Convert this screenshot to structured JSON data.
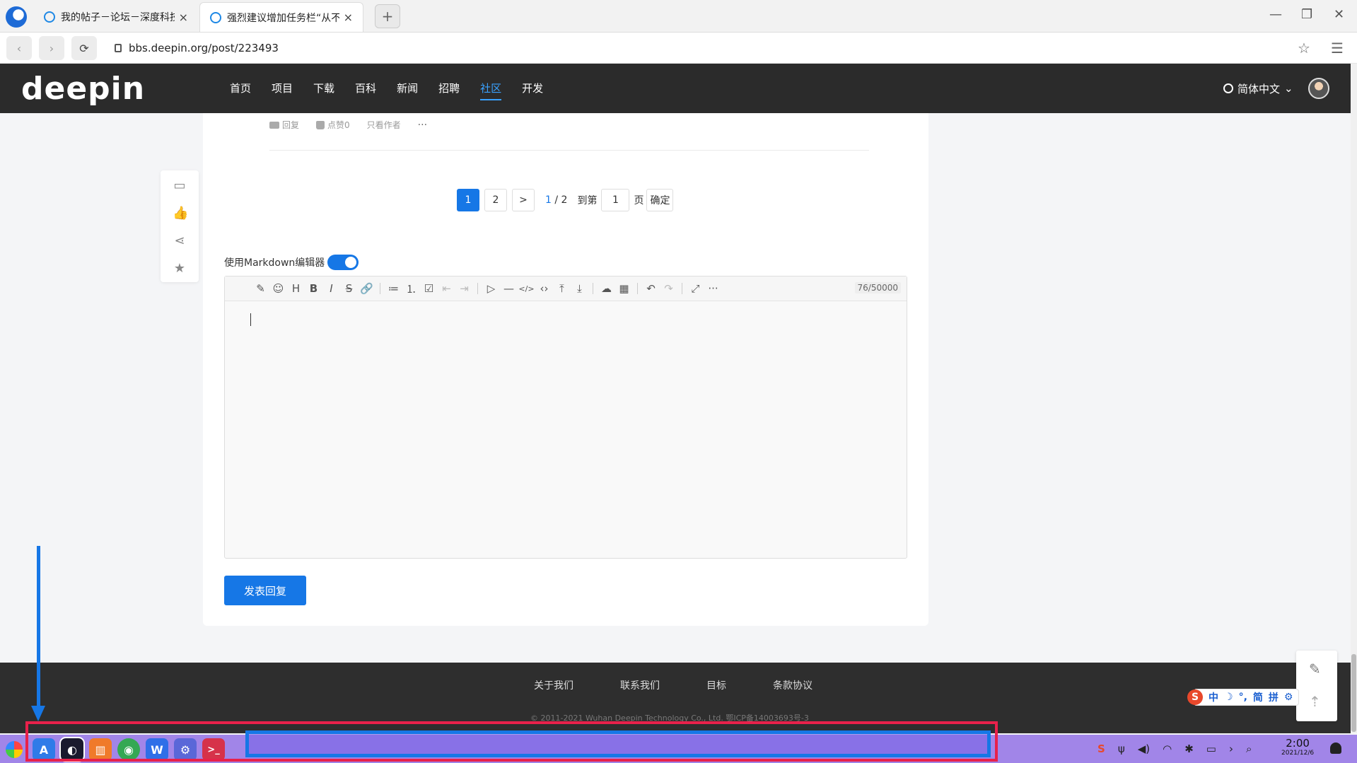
{
  "browser": {
    "tabs": [
      {
        "title": "我的帖子－论坛－深度科技",
        "close": "×"
      },
      {
        "title": "强烈建议增加任务栏“从不合并”",
        "close": "×"
      }
    ],
    "new_tab": "+",
    "window_controls": {
      "minimize": "—",
      "maximize": "❐",
      "close": "✕"
    },
    "nav": {
      "back": "‹",
      "forward": "›",
      "reload": "⟳"
    },
    "url": "bbs.deepin.org/post/223493",
    "bookmark": "☆",
    "menu": "☰"
  },
  "site": {
    "logo": "deepin",
    "nav": [
      "首页",
      "项目",
      "下载",
      "百科",
      "新闻",
      "招聘",
      "社区",
      "开发"
    ],
    "nav_active": "社区",
    "language": "简体中文",
    "language_caret": "⌄"
  },
  "post_actions": {
    "reply": "回复",
    "like": "点赞0",
    "author_only": "只看作者",
    "more": "···"
  },
  "pager": {
    "pages": [
      "1",
      "2"
    ],
    "next": ">",
    "current": "1",
    "total": "/ 2",
    "goto_prefix": "到第",
    "goto_value": "1",
    "goto_suffix": "页",
    "confirm": "确定"
  },
  "editor": {
    "markdown_label": "使用Markdown编辑器",
    "markdown_on": true,
    "counter": "76/50000",
    "toolbar_icons": [
      "✎",
      "☺",
      "H",
      "B",
      "I",
      "S",
      "🔗",
      "≔",
      "⒈",
      "☑",
      "⇤",
      "⇥",
      "▷",
      "—",
      "</>",
      "‹›",
      "⤒",
      "⤓",
      "☁",
      "▦",
      "↶",
      "↷",
      "⤢",
      "···"
    ],
    "submit": "发表回复"
  },
  "footer": {
    "links": [
      "关于我们",
      "联系我们",
      "目标",
      "条款协议"
    ],
    "copyright": "© 2011-2021 Wuhan Deepin Technology Co., Ltd.      鄂ICP备14003693号-3"
  },
  "ime": {
    "logo": "S",
    "items": [
      "中",
      "☽",
      "°,",
      "简",
      "拼",
      "⚙"
    ]
  },
  "taskbar": {
    "apps": [
      {
        "name": "app-store",
        "glyph": "A",
        "color": "#2f7be8"
      },
      {
        "name": "browser",
        "glyph": "◐",
        "color": "#1a1a2e"
      },
      {
        "name": "file-manager",
        "glyph": "▥",
        "color": "#f07a2a"
      },
      {
        "name": "chrome",
        "glyph": "◉",
        "color": "#34a853"
      },
      {
        "name": "wps",
        "glyph": "W",
        "color": "#2f6fe8"
      },
      {
        "name": "settings",
        "glyph": "⚙",
        "color": "#5a67d8"
      },
      {
        "name": "terminal",
        "glyph": ">_",
        "color": "#d6324a"
      }
    ],
    "tray": [
      "S",
      "ψ",
      "◀)",
      "◠",
      "✱",
      "▭",
      "›",
      "⌕"
    ],
    "time": "2:00",
    "date": "2021/12/6"
  }
}
